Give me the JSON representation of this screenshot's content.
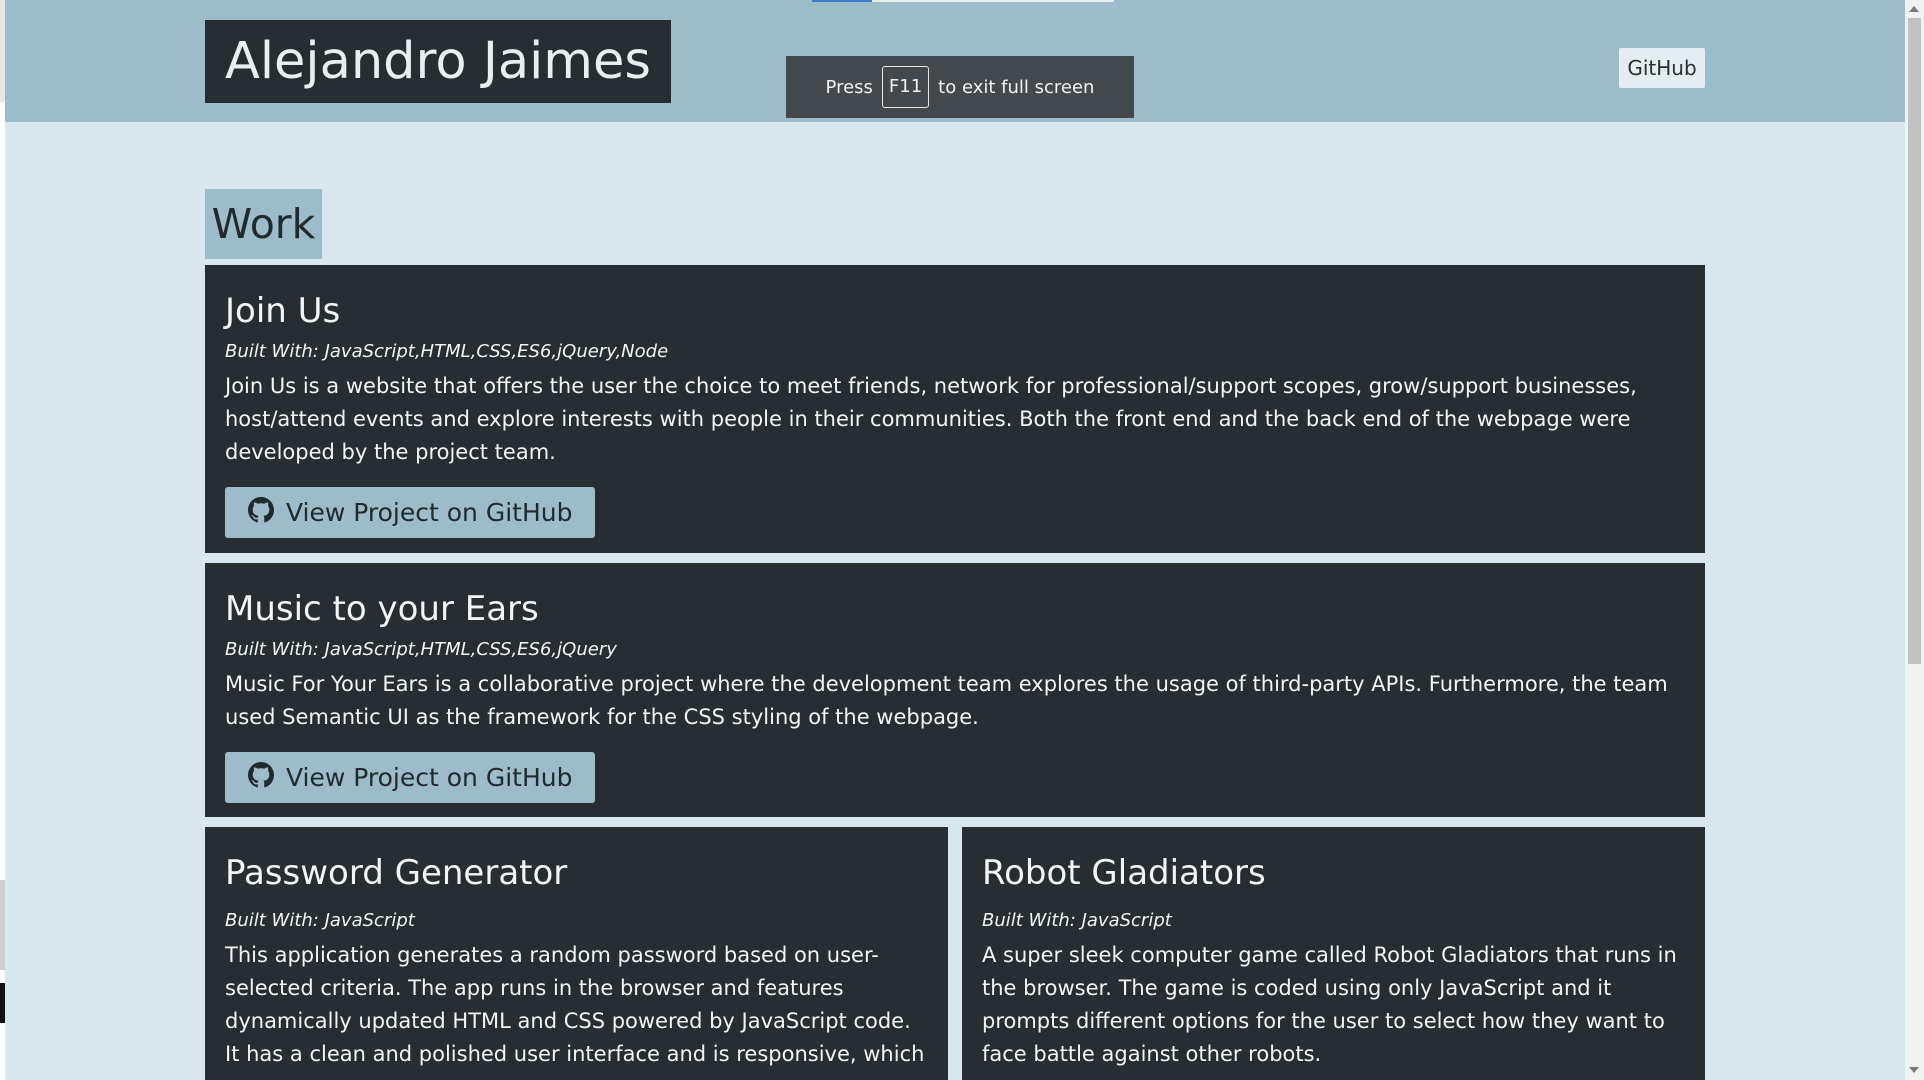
{
  "header": {
    "brand": "Alejandro Jaimes",
    "nav_github": "GitHub"
  },
  "fullscreen_notice": {
    "press": "Press",
    "key": "F11",
    "message": "to exit full screen"
  },
  "work": {
    "title": "Work",
    "projects": [
      {
        "name": "Join Us",
        "built_with": "Built With: JavaScript,HTML,CSS,ES6,jQuery,Node",
        "description": "Join Us is a website that offers the user the choice to meet friends, network for professional/support scopes, grow/support businesses, host/attend events and explore interests with people in their communities. Both the front end and the back end of the webpage were developed by the project team.",
        "button": "View Project on GitHub"
      },
      {
        "name": "Music to your Ears",
        "built_with": "Built With: JavaScript,HTML,CSS,ES6,jQuery",
        "description": "Music For Your Ears is a collaborative project where the development team explores the usage of third-party APIs. Furthermore, the team used Semantic UI as the framework for the CSS styling of the webpage.",
        "button": "View Project on GitHub"
      },
      {
        "name": "Password Generator",
        "built_with": "Built With: JavaScript",
        "description": "This application generates a random password based on user-selected criteria. The app runs in the browser and features dynamically updated HTML and CSS powered by JavaScript code. It has a clean and polished user interface and is responsive, which"
      },
      {
        "name": "Robot Gladiators",
        "built_with": "Built With: JavaScript",
        "description": "A super sleek computer game called Robot Gladiators that runs in the browser. The game is coded using only JavaScript and it prompts different options for the user to select how they want to face battle against other robots."
      }
    ]
  },
  "icons": {
    "github": "github-icon"
  },
  "colors": {
    "header_bg": "#9bbcc8",
    "page_bg": "#d8e7ee",
    "card_bg": "#272d31",
    "button_bg": "#9bbcc8"
  }
}
